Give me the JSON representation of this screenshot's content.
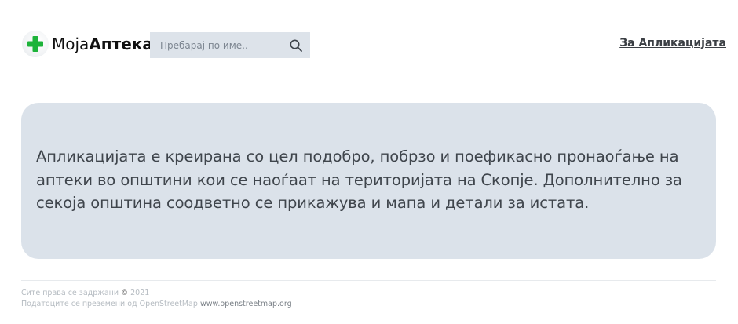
{
  "header": {
    "brand": {
      "name_light": "Моја",
      "name_bold": "Аптека",
      "logo_icon": "green-cross-icon",
      "logo_color": "#1db33a"
    },
    "search": {
      "placeholder": "Пребарај по име..",
      "value": "",
      "icon": "search-icon"
    },
    "nav": {
      "about_label": "За Апликацијата"
    }
  },
  "main": {
    "description": "Апликацијата е креирана со цел подобро, побрзо и поефикасно пронаоѓање на аптеки во општини кои се наоѓаат на територијата на Скопје. Дополнително за секоја општина соодветно се прикажува и мапа и детали за истата."
  },
  "footer": {
    "rights_text": "Сите права се задржани",
    "year": "2021",
    "source_text": "Податоците се преземени од OpenStreetMap",
    "source_link": "www.openstreetmap.org"
  },
  "colors": {
    "panel_bg": "#dbe2ea",
    "search_bg": "#dde3ea",
    "accent_green": "#1db33a"
  }
}
